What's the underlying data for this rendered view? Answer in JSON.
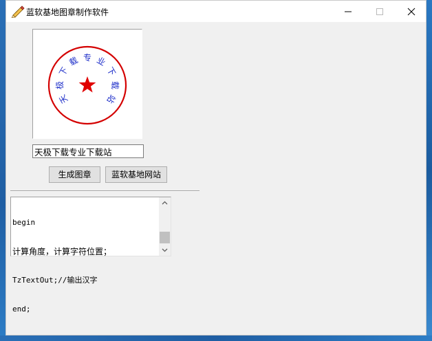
{
  "window": {
    "title": "蓝软基地图章制作软件"
  },
  "stamp": {
    "ring_text": [
      "天",
      "极",
      "下",
      "载",
      "专",
      "业",
      "下",
      "载",
      "站"
    ],
    "ring_color": "#d40000",
    "text_color": "#1d2ec9",
    "star_color": "#e00000"
  },
  "stamp_input": {
    "value": "天极下载专业下载站"
  },
  "buttons": {
    "generate": "生成图章",
    "website": "蓝软基地网站"
  },
  "memo": {
    "lines": [
      "begin",
      "计算角度，计算字符位置；",
      "TzTextOut;//输出汉字",
      "end;"
    ]
  }
}
